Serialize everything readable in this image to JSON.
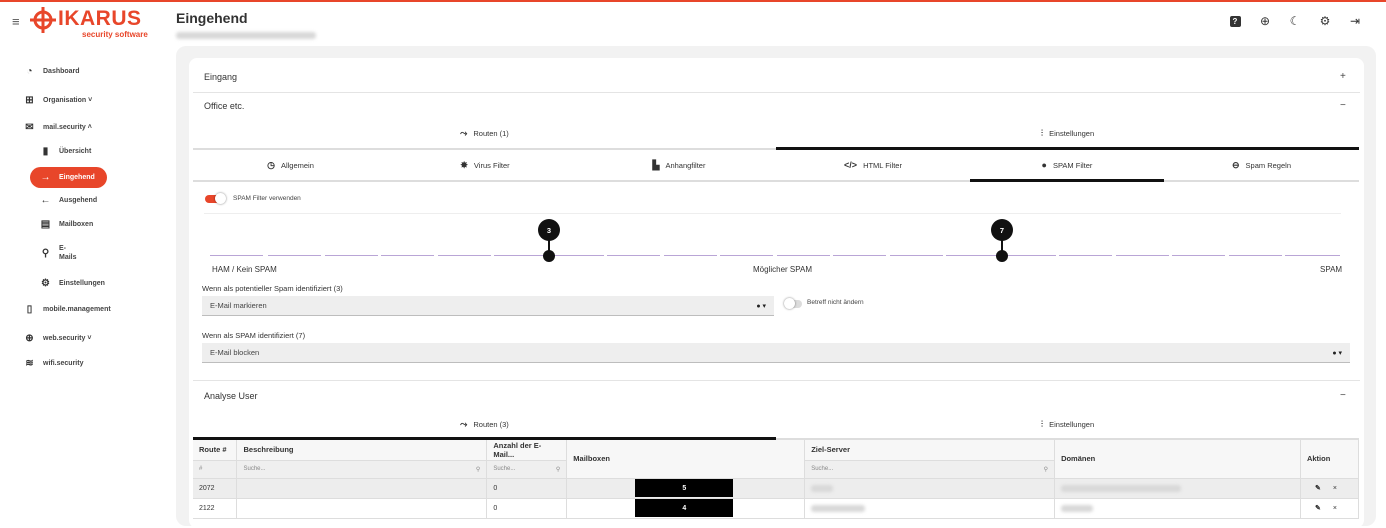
{
  "header": {
    "logo_word": "IKARUS",
    "logo_sub": "security software",
    "page_title": "Eingehend",
    "icons": [
      "help-icon",
      "globe-icon",
      "moon-icon",
      "gear-icon",
      "logout-icon"
    ]
  },
  "sidebar": {
    "items": [
      {
        "label": "Dashboard",
        "icon": "speedometer-icon"
      },
      {
        "label": "Organisation ˅",
        "icon": "org-icon"
      },
      {
        "label": "mail.security ˄",
        "icon": "mail-icon"
      },
      {
        "label": "Übersicht",
        "icon": "bar-chart-icon"
      },
      {
        "label": "Eingehend",
        "icon": "arrow-right-icon"
      },
      {
        "label": "Ausgehend",
        "icon": "arrow-left-icon"
      },
      {
        "label": "Mailboxen",
        "icon": "mailboxes-icon"
      },
      {
        "label": "E-",
        "label2": "Mails",
        "icon": "search-icon"
      },
      {
        "label": "Einstellungen",
        "icon": "gear-icon"
      },
      {
        "label": "mobile.management",
        "icon": "phone-icon"
      },
      {
        "label": "web.security ˅",
        "icon": "globe-icon"
      },
      {
        "label": "wifi.security",
        "icon": "wifi-icon"
      }
    ]
  },
  "sections": {
    "eingang": {
      "title": "Eingang",
      "toggle": "+"
    },
    "office": {
      "title": "Office etc.",
      "toggle": "−"
    },
    "analyse": {
      "title": "Analyse User",
      "toggle": "−"
    }
  },
  "office_tabs": {
    "routes": "Routen (1)",
    "settings": "Einstellungen"
  },
  "filter_tabs": [
    "Allgemein",
    "Virus Filter",
    "Anhangfilter",
    "HTML Filter",
    "SPAM Filter",
    "Spam Regeln"
  ],
  "spam": {
    "use_label": "SPAM Filter verwenden",
    "enabled": true,
    "pin_low": "3",
    "pin_high": "7",
    "scale_left": "HAM / Kein SPAM",
    "scale_mid": "Möglicher SPAM",
    "scale_right": "SPAM",
    "potential_label": "Wenn als potentieller Spam identifiziert (3)",
    "potential_value": "E-Mail markieren",
    "subject_label": "Betreff nicht ändern",
    "spam_label": "Wenn als SPAM identifiziert (7)",
    "spam_value": "E-Mail blocken"
  },
  "analyse_tabs": {
    "routes": "Routen (3)",
    "settings": "Einstellungen"
  },
  "table": {
    "headers": [
      "Route #",
      "Beschreibung",
      "Anzahl der E-Mail...",
      "Mailboxen",
      "Ziel-Server",
      "Domänen",
      "Aktion"
    ],
    "search_hash": "#",
    "search_placeholder": "Suche...",
    "rows": [
      {
        "route": "2072",
        "count": "0",
        "mailboxes": "5"
      },
      {
        "route": "2122",
        "count": "0",
        "mailboxes": "4"
      }
    ],
    "edit_glyph": "✎",
    "delete_glyph": "×"
  },
  "colors": {
    "accent": "#e8462a",
    "slider": "#b9a5d6"
  }
}
